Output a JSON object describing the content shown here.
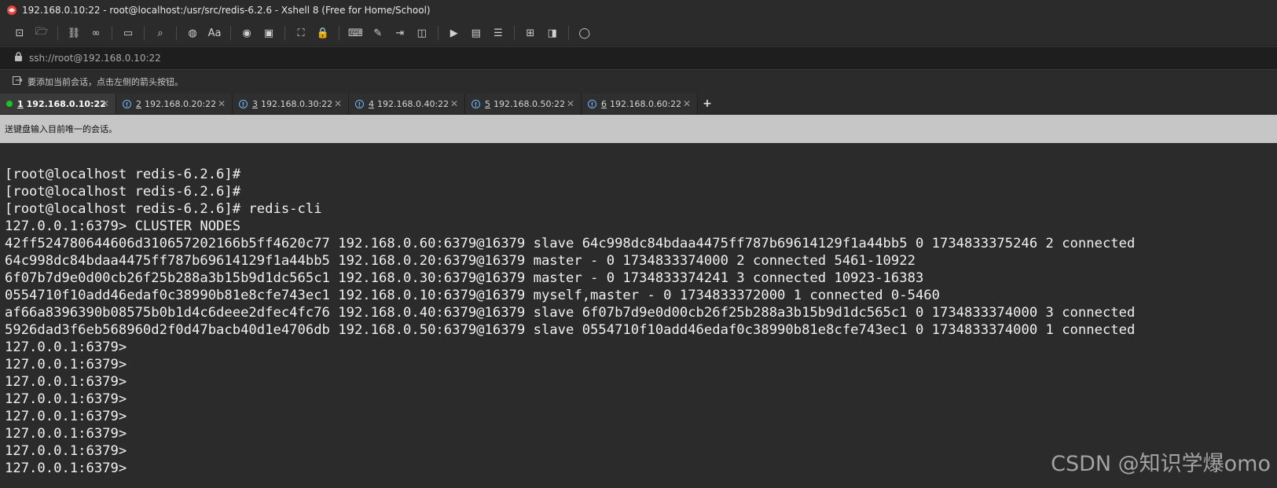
{
  "window": {
    "title": "192.168.0.10:22 - root@localhost:/usr/src/redis-6.2.6 - Xshell 8 (Free for Home/School)"
  },
  "toolbar": {
    "buttons": [
      {
        "name": "new-session-icon",
        "glyph": "⊡"
      },
      {
        "name": "open-folder-icon",
        "glyph": "🗁"
      },
      {
        "name": "disconnect-icon",
        "glyph": "⛓"
      },
      {
        "name": "reconnect-icon",
        "glyph": "∞"
      },
      {
        "name": "new-tab-icon",
        "glyph": "▭"
      },
      {
        "name": "search-icon",
        "glyph": "⌕"
      },
      {
        "name": "globe-icon",
        "glyph": "◍"
      },
      {
        "name": "font-icon",
        "glyph": "Aa"
      },
      {
        "name": "xshell-icon",
        "glyph": "◉"
      },
      {
        "name": "xftp-icon",
        "glyph": "▣"
      },
      {
        "name": "fullscreen-icon",
        "glyph": "⛶"
      },
      {
        "name": "lock-icon",
        "glyph": "🔒"
      },
      {
        "name": "keyboard-icon",
        "glyph": "⌨"
      },
      {
        "name": "compose-icon",
        "glyph": "✎"
      },
      {
        "name": "send-icon",
        "glyph": "⇥"
      },
      {
        "name": "script-icon",
        "glyph": "◫"
      },
      {
        "name": "transfer-icon",
        "glyph": "▶"
      },
      {
        "name": "log-icon",
        "glyph": "▤"
      },
      {
        "name": "list-icon",
        "glyph": "☰"
      },
      {
        "name": "new-window-icon",
        "glyph": "⊞"
      },
      {
        "name": "layout-icon",
        "glyph": "◨"
      },
      {
        "name": "help-icon",
        "glyph": "◯"
      }
    ]
  },
  "address": {
    "value": "ssh://root@192.168.0.10:22"
  },
  "hint": {
    "text": "要添加当前会话，点击左侧的箭头按钮。"
  },
  "tabs": [
    {
      "num": "1",
      "label": "192.168.0.10:22",
      "active": true,
      "status": "connected"
    },
    {
      "num": "2",
      "label": "192.168.0.20:22",
      "active": false,
      "status": "warning"
    },
    {
      "num": "3",
      "label": "192.168.0.30:22",
      "active": false,
      "status": "warning"
    },
    {
      "num": "4",
      "label": "192.168.0.40:22",
      "active": false,
      "status": "warning"
    },
    {
      "num": "5",
      "label": "192.168.0.50:22",
      "active": false,
      "status": "warning"
    },
    {
      "num": "6",
      "label": "192.168.0.60:22",
      "active": false,
      "status": "warning"
    }
  ],
  "tab_add_label": "+",
  "send_bar": {
    "text": "送键盘输入目前唯一的会话。"
  },
  "terminal": {
    "lines": [
      "",
      "[root@localhost redis-6.2.6]#",
      "[root@localhost redis-6.2.6]#",
      "[root@localhost redis-6.2.6]# redis-cli",
      "127.0.0.1:6379> CLUSTER NODES",
      "42ff524780644606d310657202166b5ff4620c77 192.168.0.60:6379@16379 slave 64c998dc84bdaa4475ff787b69614129f1a44bb5 0 1734833375246 2 connected",
      "64c998dc84bdaa4475ff787b69614129f1a44bb5 192.168.0.20:6379@16379 master - 0 1734833374000 2 connected 5461-10922",
      "6f07b7d9e0d00cb26f25b288a3b15b9d1dc565c1 192.168.0.30:6379@16379 master - 0 1734833374241 3 connected 10923-16383",
      "0554710f10add46edaf0c38990b81e8cfe743ec1 192.168.0.10:6379@16379 myself,master - 0 1734833372000 1 connected 0-5460",
      "af66a8396390b08575b0b1d4c6deee2dfec4fc76 192.168.0.40:6379@16379 slave 6f07b7d9e0d00cb26f25b288a3b15b9d1dc565c1 0 1734833374000 3 connected",
      "5926dad3f6eb568960d2f0d47bacb40d1e4706db 192.168.0.50:6379@16379 slave 0554710f10add46edaf0c38990b81e8cfe743ec1 0 1734833374000 1 connected",
      "127.0.0.1:6379>",
      "127.0.0.1:6379>",
      "127.0.0.1:6379>",
      "127.0.0.1:6379>",
      "127.0.0.1:6379>",
      "127.0.0.1:6379>",
      "127.0.0.1:6379>",
      "127.0.0.1:6379>"
    ]
  },
  "watermark": {
    "text": "CSDN @知识学爆omo"
  }
}
